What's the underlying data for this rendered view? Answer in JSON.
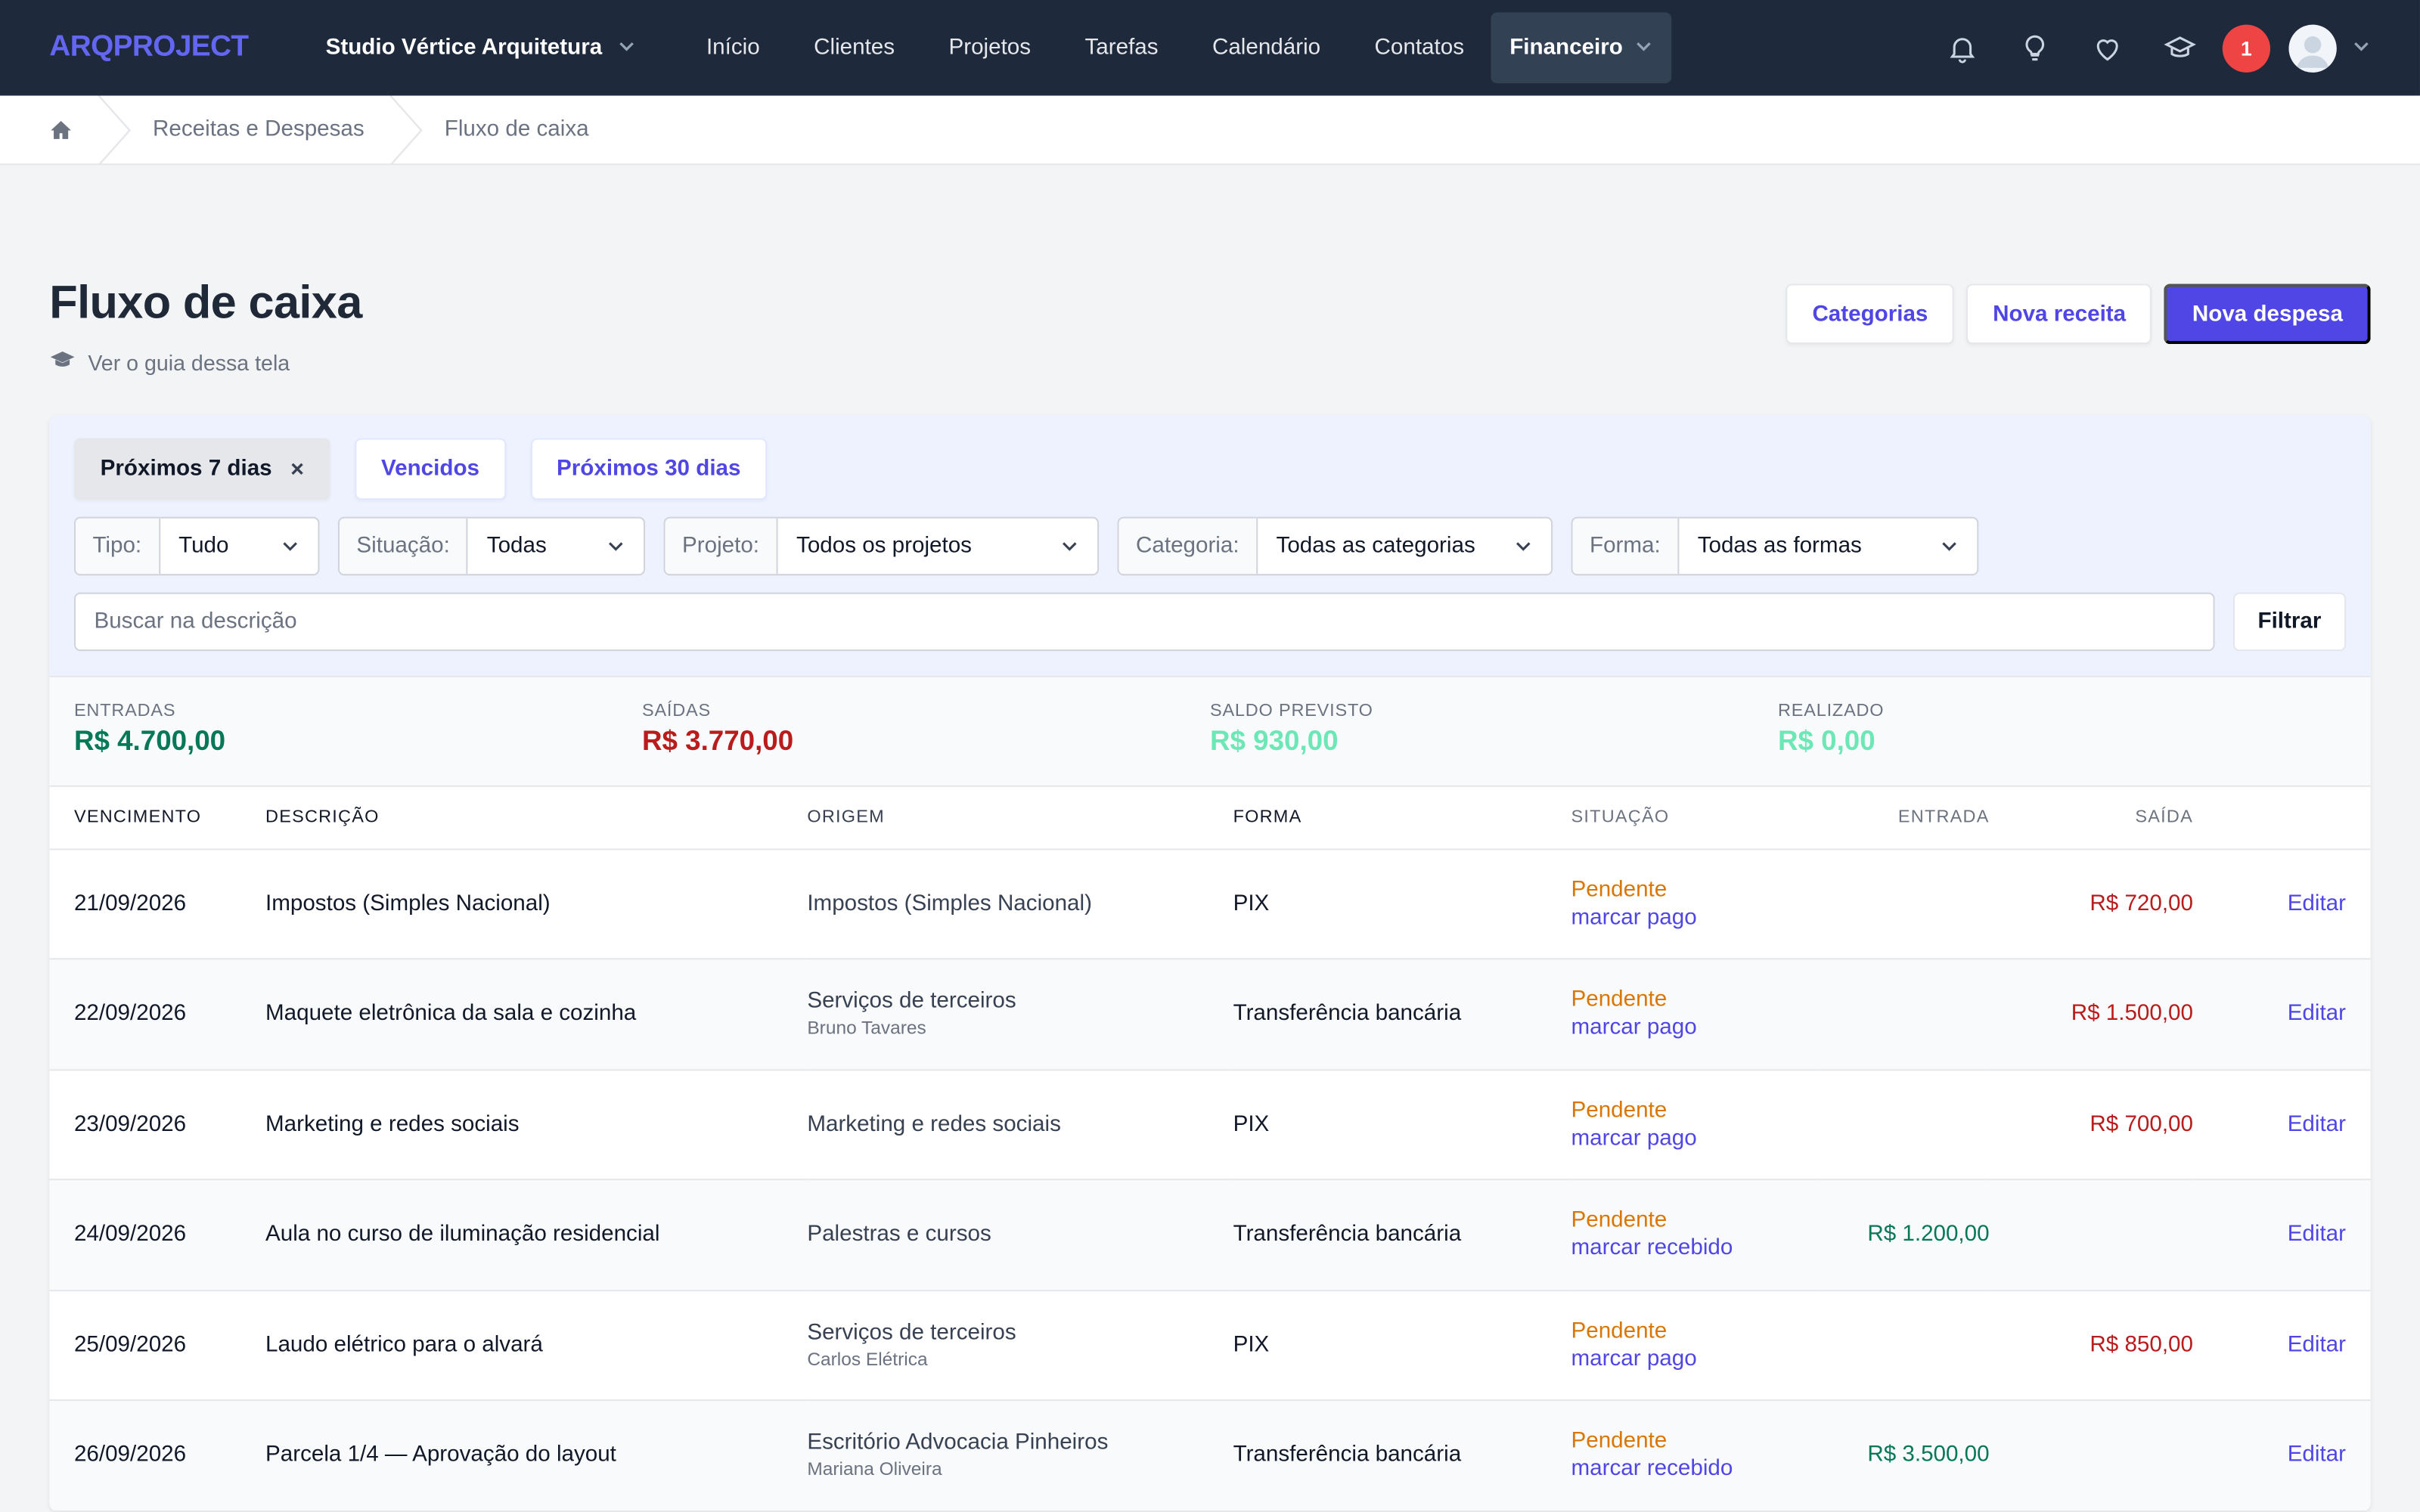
{
  "nav": {
    "logo": "ARQPROJECT",
    "studio": "Studio Vértice Arquitetura",
    "links": [
      "Início",
      "Clientes",
      "Projetos",
      "Tarefas",
      "Calendário",
      "Contatos"
    ],
    "active": "Financeiro",
    "notifications": "1"
  },
  "breadcrumb": {
    "items": [
      "Receitas e Despesas",
      "Fluxo de caixa"
    ]
  },
  "header": {
    "title": "Fluxo de caixa",
    "guide": "Ver o guia dessa tela",
    "buttons": {
      "categorias": "Categorias",
      "nova_receita": "Nova receita",
      "nova_despesa": "Nova despesa"
    }
  },
  "filters": {
    "chips": [
      "Próximos 7 dias",
      "Vencidos",
      "Próximos 30 dias"
    ],
    "chip_close": "×",
    "selects": [
      {
        "label": "Tipo:",
        "value": "Tudo"
      },
      {
        "label": "Situação:",
        "value": "Todas"
      },
      {
        "label": "Projeto:",
        "value": "Todos os projetos"
      },
      {
        "label": "Categoria:",
        "value": "Todas as categorias"
      },
      {
        "label": "Forma:",
        "value": "Todas as formas"
      }
    ],
    "search_placeholder": "Buscar na descrição",
    "filter_button": "Filtrar"
  },
  "totals": [
    {
      "label": "ENTRADAS",
      "value": "R$ 4.700,00",
      "color": "#047857"
    },
    {
      "label": "SAÍDAS",
      "value": "R$ 3.770,00",
      "color": "#b91c1c"
    },
    {
      "label": "SALDO PREVISTO",
      "value": "R$ 930,00",
      "color": "#6ee7b7"
    },
    {
      "label": "REALIZADO",
      "value": "R$ 0,00",
      "color": "#6ee7b7"
    }
  ],
  "table": {
    "headers": {
      "vencimento": "VENCIMENTO",
      "descricao": "DESCRIÇÃO",
      "origem": "ORIGEM",
      "forma": "FORMA",
      "situacao": "SITUAÇÃO",
      "entrada": "ENTRADA",
      "saida": "SAÍDA"
    },
    "edit_label": "Editar",
    "rows": [
      {
        "date": "21/09/2026",
        "desc": "Impostos (Simples Nacional)",
        "origin": "Impostos (Simples Nacional)",
        "origin_sub": "",
        "forma": "PIX",
        "status": "Pendente",
        "action": "marcar pago",
        "entrada": "",
        "saida": "R$ 720,00"
      },
      {
        "date": "22/09/2026",
        "desc": "Maquete eletrônica da sala e cozinha",
        "origin": "Serviços de terceiros",
        "origin_sub": "Bruno Tavares",
        "forma": "Transferência bancária",
        "status": "Pendente",
        "action": "marcar pago",
        "entrada": "",
        "saida": "R$ 1.500,00"
      },
      {
        "date": "23/09/2026",
        "desc": "Marketing e redes sociais",
        "origin": "Marketing e redes sociais",
        "origin_sub": "",
        "forma": "PIX",
        "status": "Pendente",
        "action": "marcar pago",
        "entrada": "",
        "saida": "R$ 700,00"
      },
      {
        "date": "24/09/2026",
        "desc": "Aula no curso de iluminação residencial",
        "origin": "Palestras e cursos",
        "origin_sub": "",
        "forma": "Transferência bancária",
        "status": "Pendente",
        "action": "marcar recebido",
        "entrada": "R$ 1.200,00",
        "saida": ""
      },
      {
        "date": "25/09/2026",
        "desc": "Laudo elétrico para o alvará",
        "origin": "Serviços de terceiros",
        "origin_sub": "Carlos Elétrica",
        "forma": "PIX",
        "status": "Pendente",
        "action": "marcar pago",
        "entrada": "",
        "saida": "R$ 850,00"
      },
      {
        "date": "26/09/2026",
        "desc": "Parcela 1/4 — Aprovação do layout",
        "origin": "Escritório Advocacia Pinheiros",
        "origin_sub": "Mariana Oliveira",
        "forma": "Transferência bancária",
        "status": "Pendente",
        "action": "marcar recebido",
        "entrada": "R$ 3.500,00",
        "saida": ""
      }
    ]
  }
}
